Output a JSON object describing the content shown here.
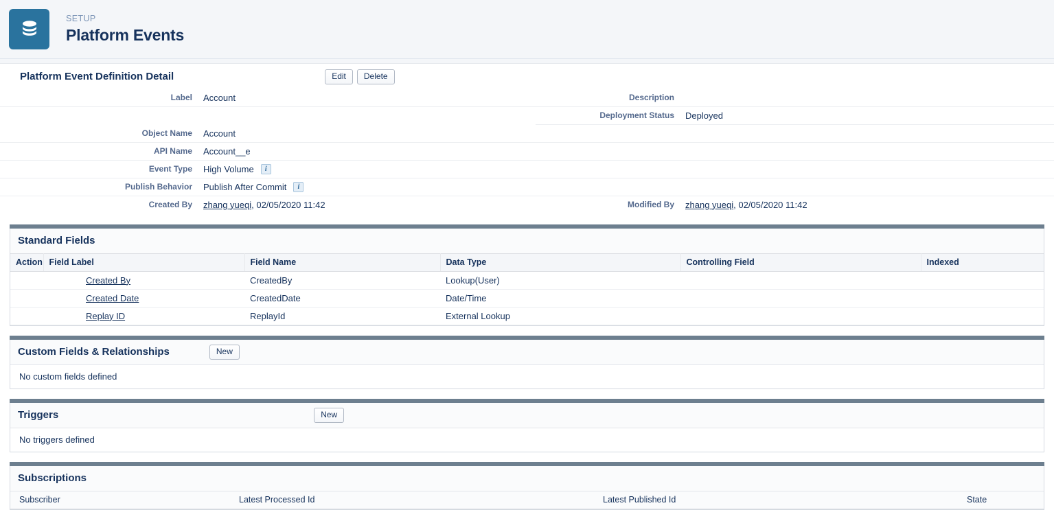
{
  "header": {
    "eyebrow": "SETUP",
    "title": "Platform Events",
    "icon": "database-stack-icon",
    "icon_bg": "#2a739e"
  },
  "detail": {
    "title": "Platform Event Definition Detail",
    "buttons": [
      {
        "label": "Edit",
        "name": "edit-button"
      },
      {
        "label": "Delete",
        "name": "delete-button"
      }
    ],
    "left_fields": [
      {
        "label": "Label",
        "value": "Account"
      },
      {
        "label": "",
        "value": ""
      },
      {
        "label": "Object Name",
        "value": "Account"
      },
      {
        "label": "API Name",
        "value": "Account__e"
      },
      {
        "label": "Event Type",
        "value": "High Volume",
        "info": "i"
      },
      {
        "label": "Publish Behavior",
        "value": "Publish After Commit",
        "info": "i"
      },
      {
        "label": "Created By",
        "link": "zhang yueqi",
        "value": ", 02/05/2020 11:42"
      }
    ],
    "right_fields": [
      {
        "label": "Description",
        "value": ""
      },
      {
        "label": "Deployment Status",
        "value": "Deployed"
      },
      {
        "label": "",
        "value": ""
      },
      {
        "label": "",
        "value": ""
      },
      {
        "label": "",
        "value": ""
      },
      {
        "label": "",
        "value": ""
      },
      {
        "label": "Modified By",
        "link": "zhang yueqi",
        "value": ", 02/05/2020 11:42"
      }
    ]
  },
  "standard_fields": {
    "title": "Standard Fields",
    "columns": [
      "Action",
      "Field Label",
      "Field Name",
      "Data Type",
      "Controlling Field",
      "Indexed"
    ],
    "rows": [
      {
        "action": "",
        "field_label": "Created By",
        "field_name": "CreatedBy",
        "data_type": "Lookup(User)",
        "controlling_field": "",
        "indexed": ""
      },
      {
        "action": "",
        "field_label": "Created Date",
        "field_name": "CreatedDate",
        "data_type": "Date/Time",
        "controlling_field": "",
        "indexed": ""
      },
      {
        "action": "",
        "field_label": "Replay ID",
        "field_name": "ReplayId",
        "data_type": "External Lookup",
        "controlling_field": "",
        "indexed": ""
      }
    ]
  },
  "custom_fields": {
    "title": "Custom Fields & Relationships",
    "new_label": "New",
    "empty_text": "No custom fields defined"
  },
  "triggers": {
    "title": "Triggers",
    "new_label": "New",
    "empty_text": "No triggers defined"
  },
  "subscriptions": {
    "title": "Subscriptions",
    "columns": [
      "Subscriber",
      "Latest Processed Id",
      "Latest Published Id",
      "State"
    ]
  }
}
